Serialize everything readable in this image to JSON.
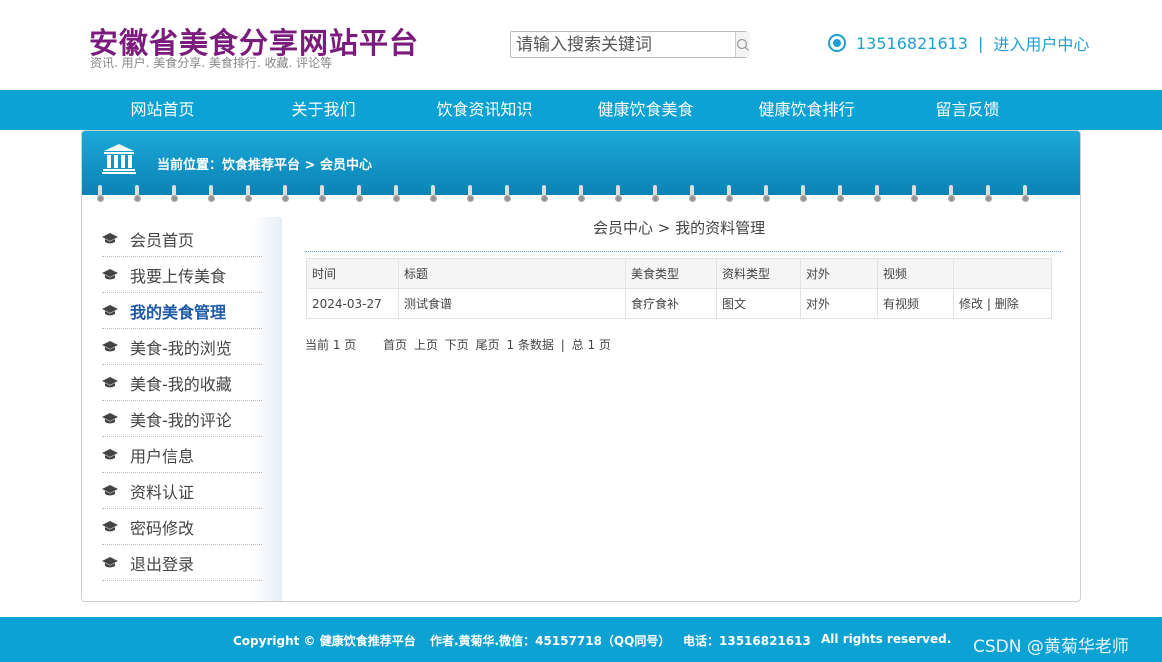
{
  "header": {
    "title": "安徽省美食分享网站平台",
    "subtitle": "资讯. 用户. 美食分享. 美食排行. 收藏. 评论等",
    "search_placeholder": "请输入搜索关键词",
    "phone": "13516821613",
    "separator": "|",
    "user_center": "进入用户中心"
  },
  "nav": {
    "items": [
      "网站首页",
      "关于我们",
      "饮食资讯知识",
      "健康饮食美食",
      "健康饮食排行",
      "留言反馈"
    ]
  },
  "panel": {
    "breadcrumb": "当前位置：饮食推荐平台 > 会员中心"
  },
  "sidebar": {
    "items": [
      {
        "label": "会员首页"
      },
      {
        "label": "我要上传美食"
      },
      {
        "label": "我的美食管理"
      },
      {
        "label": "美食-我的浏览"
      },
      {
        "label": "美食-我的收藏"
      },
      {
        "label": "美食-我的评论"
      },
      {
        "label": "用户信息"
      },
      {
        "label": "资料认证"
      },
      {
        "label": "密码修改"
      },
      {
        "label": "退出登录"
      }
    ],
    "active_index": 2
  },
  "content": {
    "title": "会员中心 > 我的资料管理",
    "table": {
      "headers": [
        "时间",
        "标题",
        "美食类型",
        "资料类型",
        "对外",
        "视频",
        ""
      ],
      "rows": [
        {
          "time": "2024-03-27",
          "title": "测试食谱",
          "food_type": "食疗食补",
          "data_type": "图文",
          "public": "对外",
          "video": "有视频",
          "edit": "修改",
          "sep": "|",
          "delete": "删除"
        }
      ]
    },
    "pager": {
      "current": "当前 1 页",
      "first": "首页",
      "prev": "上页",
      "next": "下页",
      "last": "尾页",
      "count": "1 条数据",
      "sep": "|",
      "total": "总 1 页"
    }
  },
  "footer": {
    "copyright": "Copyright © 健康饮食推荐平台",
    "author": "作者.黄菊华.微信：45157718（QQ同号）",
    "phone": "电话：13516821613",
    "rights": "All rights reserved.",
    "watermark": "CSDN @黄菊华老师"
  },
  "colors": {
    "brand_title": "#7b1c7d",
    "nav_bg": "#0ca2d4",
    "link": "#1f9ed0",
    "active_side": "#1e5aa8"
  },
  "icons": {
    "search": "search-icon",
    "phone": "phone-icon",
    "breadcrumb": "bank-building-icon",
    "sidebar": "graduation-cap-icon"
  }
}
